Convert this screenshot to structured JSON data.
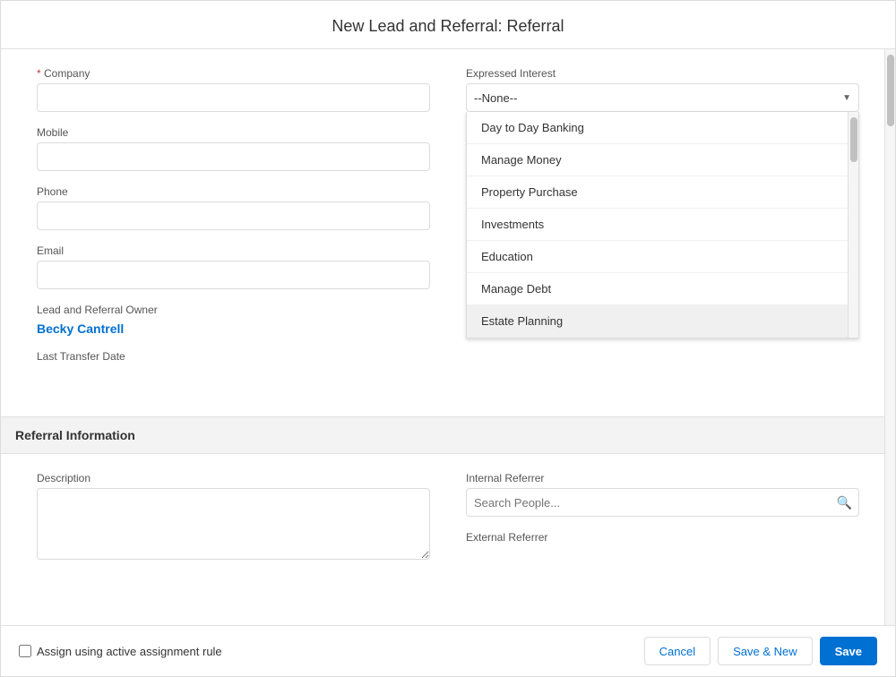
{
  "modal": {
    "title": "New Lead and Referral: Referral"
  },
  "form": {
    "company_label": "Company",
    "mobile_label": "Mobile",
    "phone_label": "Phone",
    "email_label": "Email",
    "owner_label": "Lead and Referral Owner",
    "owner_value": "Becky Cantrell",
    "transfer_date_label": "Last Transfer Date",
    "transfer_date_value": "",
    "expressed_interest_label": "Expressed Interest",
    "expressed_interest_value": "--None--",
    "dropdown_items": [
      "Day to Day Banking",
      "Manage Money",
      "Property Purchase",
      "Investments",
      "Education",
      "Manage Debt",
      "Estate Planning"
    ],
    "selected_dropdown_item": "Estate Planning"
  },
  "referral_section": {
    "header": "Referral Information",
    "description_label": "Description",
    "internal_referrer_label": "Internal Referrer",
    "internal_referrer_placeholder": "Search People...",
    "external_referrer_label": "External Referrer"
  },
  "footer": {
    "checkbox_label": "Assign using active assignment rule",
    "cancel_label": "Cancel",
    "save_new_label": "Save & New",
    "save_label": "Save"
  },
  "icons": {
    "dropdown_arrow": "▼",
    "search": "🔍",
    "scrollbar_up": "▲",
    "scrollbar_down": "▼"
  }
}
